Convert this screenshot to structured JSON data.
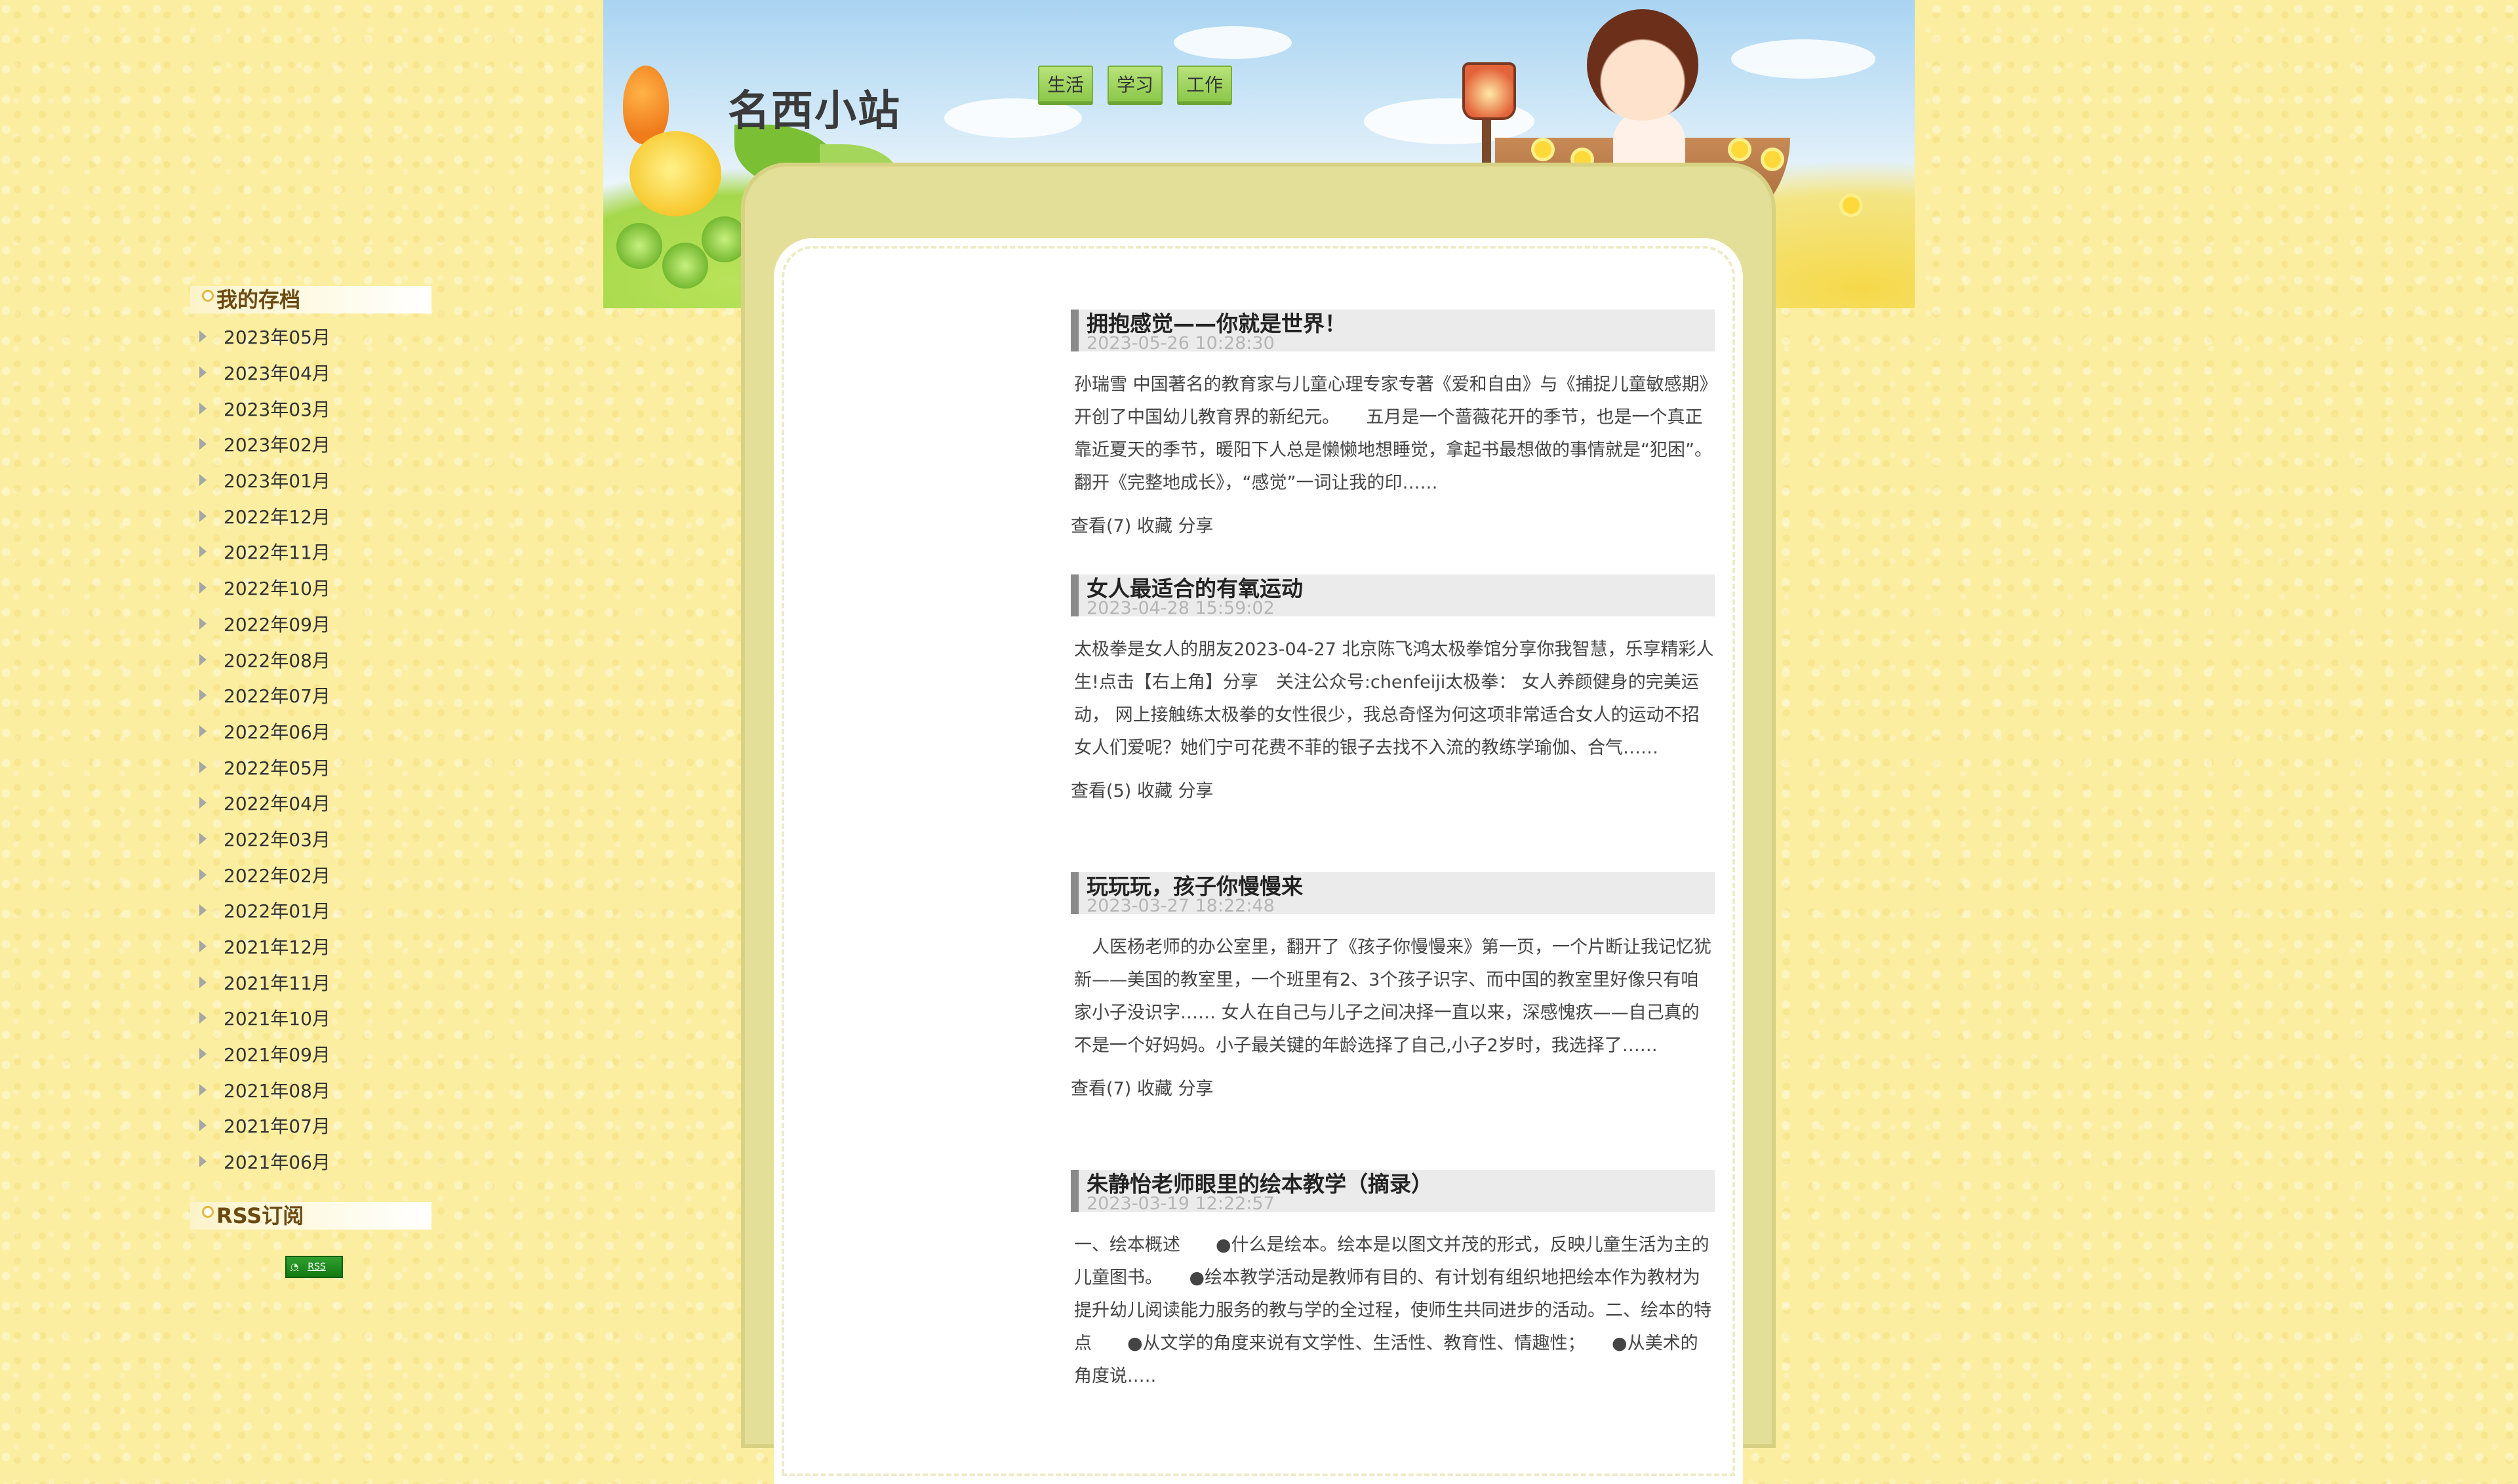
{
  "site": {
    "title": "名西小站"
  },
  "nav": {
    "items": [
      {
        "label": "生活"
      },
      {
        "label": "学习"
      },
      {
        "label": "工作"
      }
    ]
  },
  "sidebar": {
    "archive_title": "我的存档",
    "archive": [
      "2023年05月",
      "2023年04月",
      "2023年03月",
      "2023年02月",
      "2023年01月",
      "2022年12月",
      "2022年11月",
      "2022年10月",
      "2022年09月",
      "2022年08月",
      "2022年07月",
      "2022年06月",
      "2022年05月",
      "2022年04月",
      "2022年03月",
      "2022年02月",
      "2022年01月",
      "2021年12月",
      "2021年11月",
      "2021年10月",
      "2021年09月",
      "2021年08月",
      "2021年07月",
      "2021年06月"
    ],
    "rss_title": "RSS订阅",
    "rss_badge": "RSS"
  },
  "posts": [
    {
      "title": "拥抱感觉——你就是世界！",
      "date": "2023-05-26 10:28:30",
      "excerpt": "孙瑞雪  中国著名的教育家与儿童心理专家专著《爱和自由》与《捕捉儿童敏感期》开创了中国幼儿教育界的新纪元。　　五月是一个蔷薇花开的季节，也是一个真正靠近夏天的季节，暖阳下人总是懒懒地想睡觉，拿起书最想做的事情就是“犯困”。翻开《完整地成长》，“感觉”一词让我的印……",
      "views": "查看(7)",
      "favorite": "收藏",
      "share": "分享"
    },
    {
      "title": "女人最适合的有氧运动",
      "date": "2023-04-28 15:59:02",
      "excerpt": "太极拳是女人的朋友2023-04-27 北京陈飞鸿太极拳馆分享你我智慧，乐享精彩人生!点击【右上角】分享　关注公众号:chenfeiji太极拳：  女人养颜健身的完美运动，  网上接触练太极拳的女性很少，我总奇怪为何这项非常适合女人的运动不招女人们爱呢？她们宁可花费不菲的银子去找不入流的教练学瑜伽、合气……",
      "views": "查看(5)",
      "favorite": "收藏",
      "share": "分享"
    },
    {
      "title": "玩玩玩，孩子你慢慢来",
      "date": "2023-03-27 18:22:48",
      "excerpt": "　人医杨老师的办公室里，翻开了《孩子你慢慢来》第一页，一个片断让我记忆犹新——美国的教室里，一个班里有2、3个孩子识字、而中国的教室里好像只有咱家小子没识字…… 女人在自己与儿子之间决择一直以来，深感愧疚——自己真的不是一个好妈妈。小子最关键的年龄选择了自己,小子2岁时，我选择了……",
      "views": "查看(7)",
      "favorite": "收藏",
      "share": "分享"
    },
    {
      "title": "朱静怡老师眼里的绘本教学（摘录）",
      "date": "2023-03-19 12:22:57",
      "excerpt": "一、绘本概述　　●什么是绘本。绘本是以图文并茂的形式，反映儿童生活为主的儿童图书。　　●绘本教学活动是教师有目的、有计划有组织地把绘本作为教材为提升幼儿阅读能力服务的教与学的全过程，使师生共同进步的活动。二、绘本的特点　　●从文学的角度来说有文学性、生活性、教育性、情趣性；　　●从美术的角度说.…."
    }
  ]
}
